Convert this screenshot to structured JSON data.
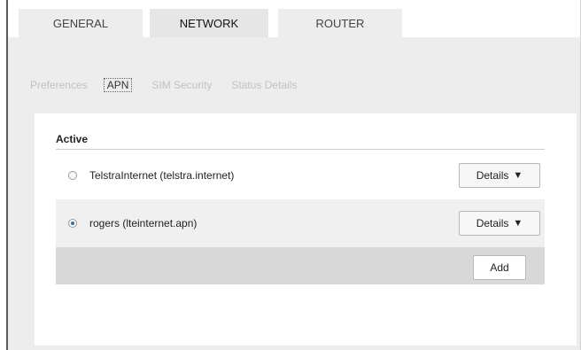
{
  "tabs": {
    "general": "GENERAL",
    "network": "NETWORK",
    "router": "ROUTER"
  },
  "subnav": {
    "preferences": "Preferences",
    "apn": "APN",
    "sim_security": "SIM Security",
    "status_details": "Status Details"
  },
  "card": {
    "title": "Active",
    "rows": [
      {
        "label": "TelstraInternet (telstra.internet)",
        "selected": false,
        "button": "Details"
      },
      {
        "label": "rogers (lteinternet.apn)",
        "selected": true,
        "button": "Details"
      }
    ],
    "add_label": "Add"
  },
  "icons": {
    "dropdown": "triangle-down-icon",
    "radio": "radio-button-icon"
  },
  "colors": {
    "active_radio": "#3a6db0",
    "panel_bg": "#ededed"
  }
}
